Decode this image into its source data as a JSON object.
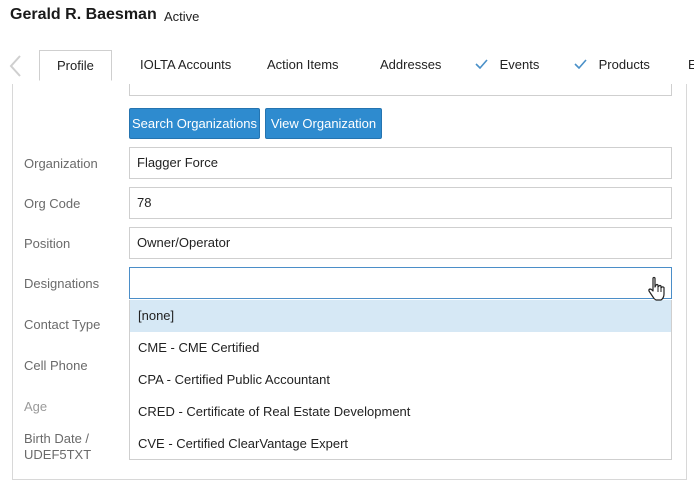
{
  "header": {
    "name": "Gerald R. Baesman",
    "status": "Active"
  },
  "tabs": [
    {
      "label": "Profile",
      "checked": false,
      "active": true
    },
    {
      "label": "IOLTA Accounts",
      "checked": false,
      "active": false
    },
    {
      "label": "Action Items",
      "checked": false,
      "active": false
    },
    {
      "label": "Addresses",
      "checked": false,
      "active": false
    },
    {
      "label": "Events",
      "checked": true,
      "active": false
    },
    {
      "label": "Products",
      "checked": true,
      "active": false
    },
    {
      "label": "E",
      "checked": false,
      "active": false
    }
  ],
  "buttons": {
    "search_org": "Search Organizations",
    "view_org": "View Organization"
  },
  "form": {
    "organization": {
      "label": "Organization",
      "value": "Flagger Force"
    },
    "org_code": {
      "label": "Org Code",
      "value": "78"
    },
    "position": {
      "label": "Position",
      "value": "Owner/Operator"
    },
    "designations": {
      "label": "Designations",
      "value": ""
    },
    "contact_type": {
      "label": "Contact Type"
    },
    "cell_phone": {
      "label": "Cell Phone"
    },
    "age": {
      "label": "Age"
    },
    "birth_date": {
      "label_line1": "Birth Date /",
      "label_line2": "UDEF5TXT"
    }
  },
  "designation_options": [
    "[none]",
    "CME - CME Certified",
    "CPA - Certified Public Accountant",
    "CRED - Certificate of Real Estate Development",
    "CVE - Certified ClearVantage Expert"
  ],
  "colors": {
    "accent": "#2e8bcf",
    "selected_option": "#d6e8f5",
    "check": "#4a90c8"
  }
}
